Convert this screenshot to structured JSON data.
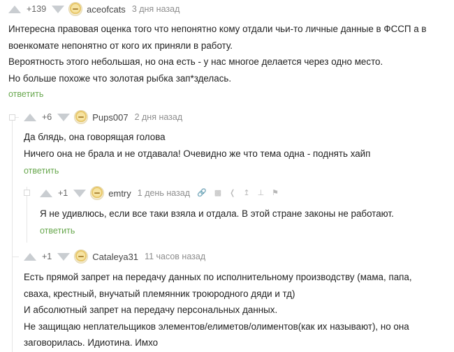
{
  "comments": [
    {
      "rating": "+139",
      "author": "aceofcats",
      "time": "3 дня назад",
      "lines": [
        "Интересна правовая оценка того что непонятно кому отдали чьи-то личные данные в ФССП а в",
        "военкомате непонятно от кого их приняли в работу.",
        "Вероятность этого небольшая, но она есть - у нас многое делается через одно место.",
        "Но больше похоже что золотая рыбка зап*зделась."
      ],
      "reply": "ответить"
    },
    {
      "rating": "+6",
      "author": "Pups007",
      "time": "2 дня назад",
      "lines": [
        "Да блядь, она говорящая голова",
        "Ничего она не брала и не отдавала! Очевидно же что тема одна - поднять хайп"
      ],
      "reply": "ответить"
    },
    {
      "rating": "+1",
      "author": "emtry",
      "time": "1 день назад",
      "lines": [
        "Я не удивлюсь, если все таки взяла и отдала. В этой стране законы не работают."
      ],
      "reply": "ответить",
      "tools": [
        "link-icon",
        "save-icon",
        "share-icon",
        "tree-icon",
        "vote-icon",
        "flag-icon"
      ]
    },
    {
      "rating": "+1",
      "author": "Cataleya31",
      "time": "11 часов назад",
      "lines": [
        "Есть прямой запрет на передачу данных по исполнительному производству (мама, папа,",
        "сваха, крестный, внучатый племянник троюродного дяди и тд)",
        "И абсолютный запрет на передачу персональных данных.",
        "Не защищаю неплательщиков элементов/елиметов/олиментов(как их называют), но она",
        "заговорилась. Идиотина. Имхо"
      ]
    }
  ],
  "colors": {
    "reply": "#69a84f",
    "arrow": "#c9cdd1",
    "time": "#8e8e8e"
  }
}
